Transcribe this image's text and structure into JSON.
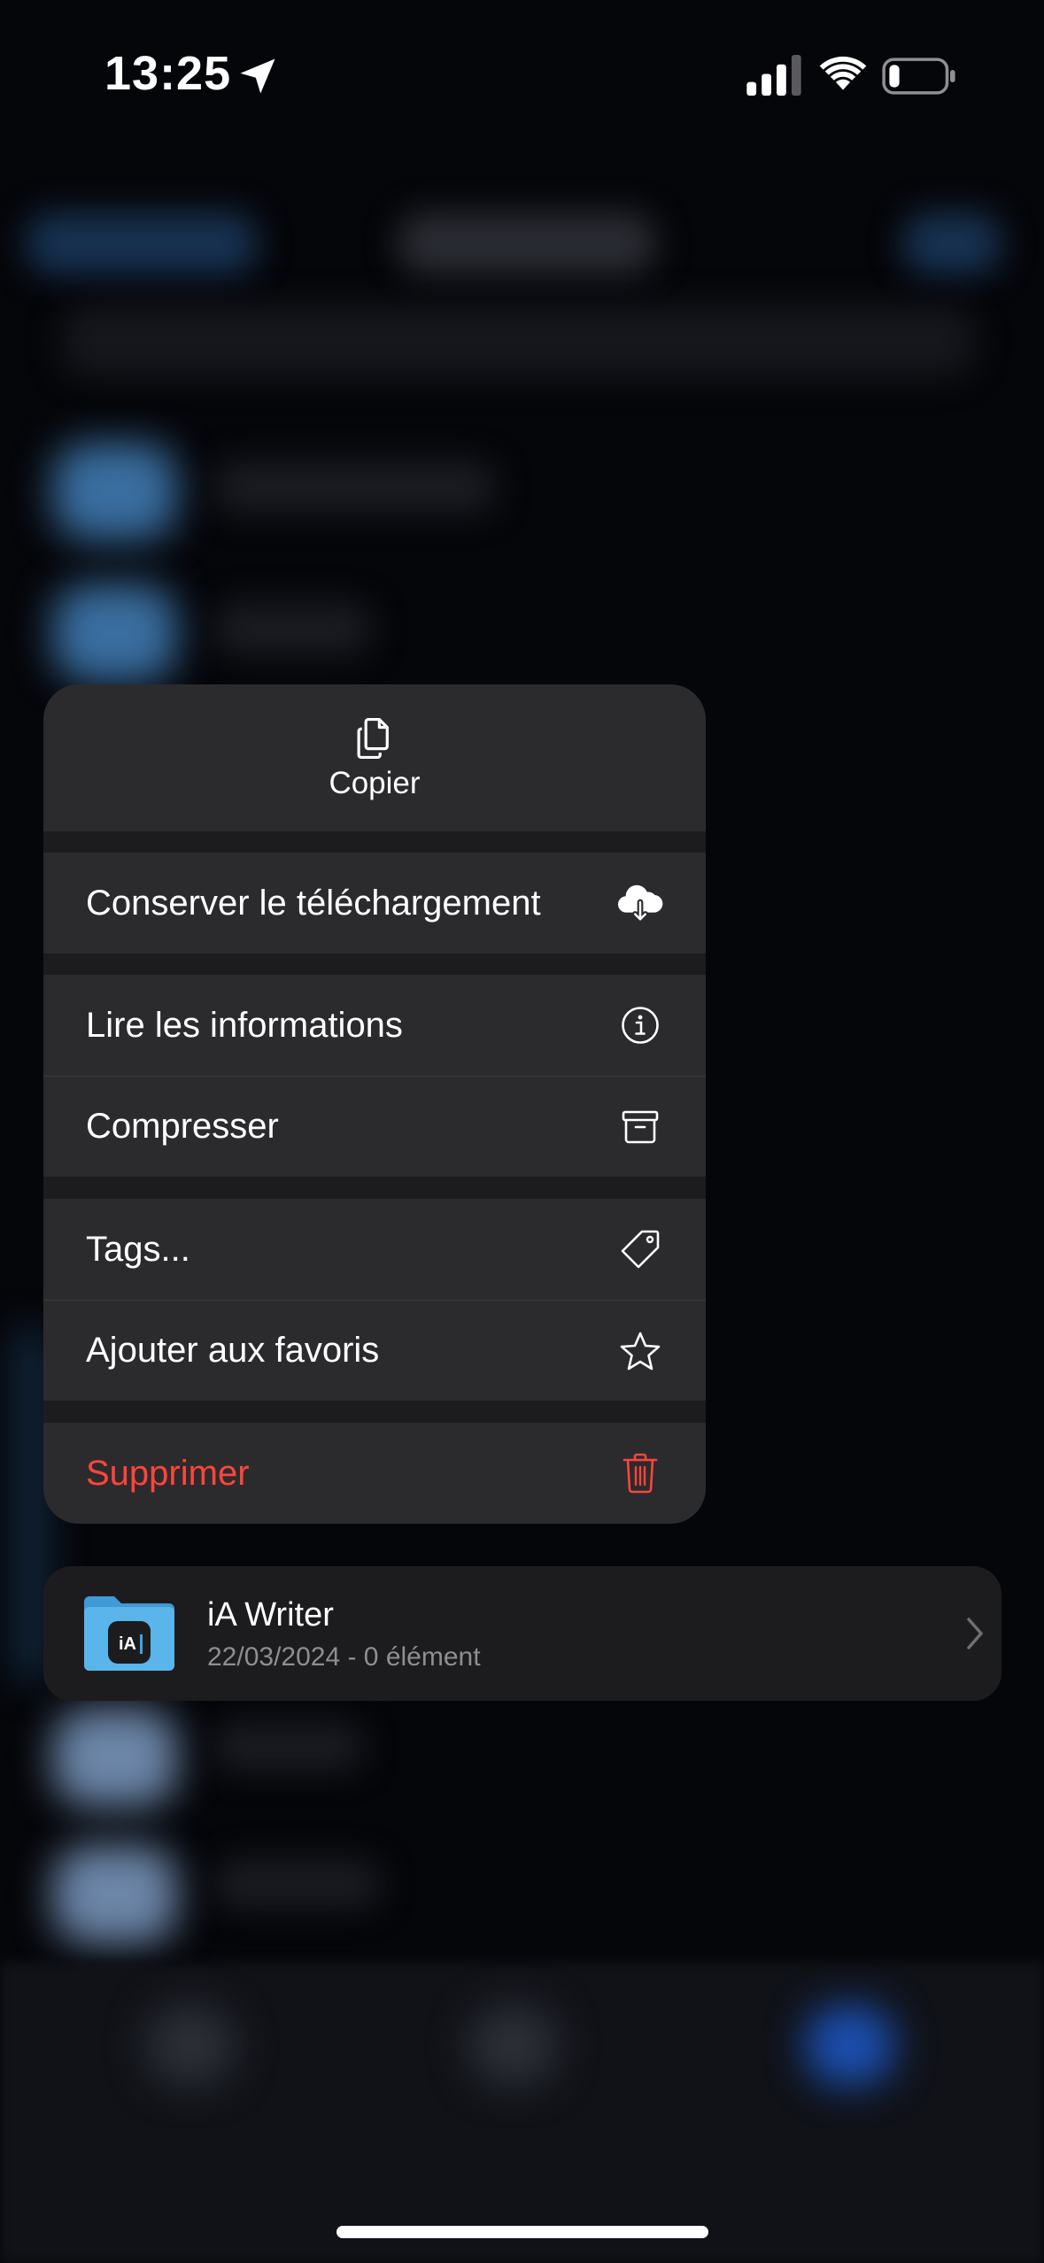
{
  "status_bar": {
    "time": "13:25"
  },
  "menu": {
    "copy_label": "Copier",
    "items": [
      {
        "label": "Conserver le téléchargement",
        "icon": "cloud-download-icon"
      },
      {
        "label": "Lire les informations",
        "icon": "info-icon"
      },
      {
        "label": "Compresser",
        "icon": "archive-box-icon"
      },
      {
        "label": "Tags...",
        "icon": "tag-icon"
      },
      {
        "label": "Ajouter aux favoris",
        "icon": "star-icon"
      },
      {
        "label": "Supprimer",
        "icon": "trash-icon"
      }
    ]
  },
  "folder": {
    "name": "iA Writer",
    "meta": "22/03/2024 - 0 élément",
    "badge": "iA"
  },
  "colors": {
    "danger": "#ff453a",
    "folder_blue": "#5ab5ea",
    "menu_bg": "#2b2b2e"
  }
}
